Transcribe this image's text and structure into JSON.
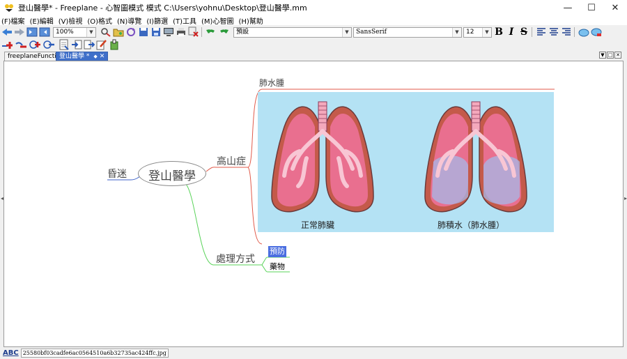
{
  "window": {
    "title": "登山醫學* - Freeplane - 心智圖模式 模式 C:\\Users\\yohnu\\Desktop\\登山醫學.mm",
    "minimize_glyph": "—",
    "maximize_glyph": "☐",
    "close_glyph": "✕"
  },
  "menu": [
    "(F)檔案",
    "(E)編輯",
    "(V)檢視",
    "(O)格式",
    "(N)導覽",
    "(I)篩選",
    "(T)工具",
    "(M)心智圖",
    "(H)幫助"
  ],
  "toolbar": {
    "zoom_value": "100%",
    "style_value": "預設",
    "font_value": "SansSerif",
    "font_size_value": "12",
    "bold_label": "B",
    "italic_label": "I",
    "strike_label": "S"
  },
  "tabs": [
    {
      "label": "freeplaneFunctions",
      "active": false
    },
    {
      "label": "登山醫學 *",
      "active": true
    }
  ],
  "tab_close_glyph": "✕",
  "mindmap": {
    "root": "登山醫學",
    "left_node": "昏迷",
    "branch_altitude": "高山症",
    "sub_pulmonary_edema": "肺水腫",
    "branch_treatment": "處理方式",
    "sub_prevention": "預防",
    "sub_medicine": "藥物",
    "image_caption_normal": "正常肺臟",
    "image_caption_edema": "肺積水（肺水腫）"
  },
  "colors": {
    "tab_active": "#3f6fc9",
    "edge_red": "#e05a4a",
    "edge_green": "#5ad35a",
    "edge_blue": "#3e62c8",
    "image_bg": "#b4e2f4",
    "lung_outer": "#c45a4a",
    "lung_inner": "#e96f8f",
    "selected_node": "#4a6ee0"
  },
  "status": {
    "abc_label": "ABC",
    "file_hash": "25580bf03cadfe6ac0564510a6b32735ac424ffc.jpg"
  }
}
